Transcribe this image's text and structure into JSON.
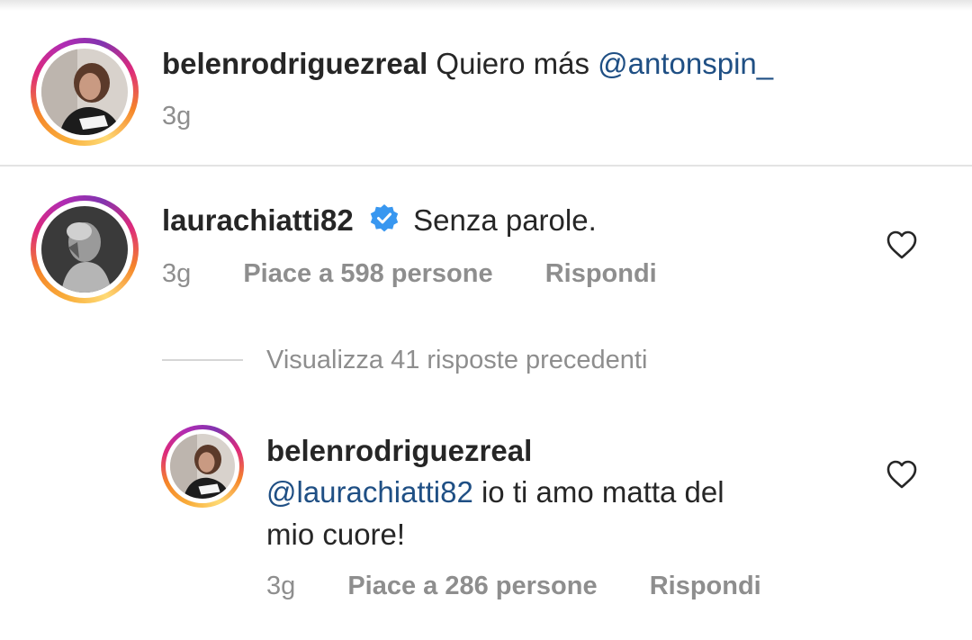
{
  "comments": [
    {
      "username": "belenrodriguezreal",
      "text": "Quiero más",
      "mention": "@antonspin_",
      "time": "3g"
    },
    {
      "username": "laurachiatti82",
      "verified": true,
      "text": "Senza parole.",
      "time": "3g",
      "likes_label": "Piace a 598 persone",
      "reply_label": "Rispondi",
      "heart_icon": "heart-outline-icon"
    }
  ],
  "view_replies_label": "Visualizza 41 risposte precedenti",
  "reply": {
    "username": "belenrodriguezreal",
    "mention": "@laurachiatti82",
    "text_line1": "io ti amo matta del",
    "text_line2": "mio cuore!",
    "time": "3g",
    "likes_label": "Piace a 286 persone",
    "reply_label": "Rispondi",
    "heart_icon": "heart-outline-icon"
  },
  "colors": {
    "mention": "#1f4f84",
    "meta": "#8e8e8e",
    "verified": "#3897f0",
    "text": "#262626"
  }
}
